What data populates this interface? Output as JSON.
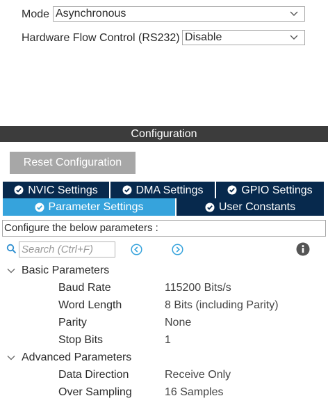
{
  "mode_section": {
    "mode_label": "Mode",
    "mode_value": "Asynchronous",
    "flow_label": "Hardware Flow Control (RS232)",
    "flow_value": "Disable"
  },
  "configuration": {
    "title": "Configuration",
    "reset_label": "Reset Configuration"
  },
  "tabs": {
    "nvic": "NVIC Settings",
    "dma": "DMA Settings",
    "gpio": "GPIO Settings",
    "parameter": "Parameter Settings",
    "user_constants": "User Constants"
  },
  "params_panel": {
    "hint": "Configure the below parameters :",
    "search_placeholder": "Search (Ctrl+F)"
  },
  "groups": {
    "basic": {
      "label": "Basic Parameters",
      "items": [
        {
          "name": "Baud Rate",
          "value": "115200 Bits/s"
        },
        {
          "name": "Word Length",
          "value": "8 Bits (including Parity)"
        },
        {
          "name": "Parity",
          "value": "None"
        },
        {
          "name": "Stop Bits",
          "value": "1"
        }
      ]
    },
    "advanced": {
      "label": "Advanced Parameters",
      "items": [
        {
          "name": "Data Direction",
          "value": "Receive Only"
        },
        {
          "name": "Over Sampling",
          "value": "16 Samples"
        }
      ]
    }
  },
  "colors": {
    "tab_dark": "#07294d",
    "tab_active": "#36a3dc",
    "config_bar": "#3c3c3c",
    "reset_button": "#a7a7a7",
    "nav_icon": "#36a3dc"
  },
  "icons": {
    "chevron": "chevron-down-icon",
    "check": "check-circle-icon",
    "search": "search-icon",
    "prev": "previous-icon",
    "next": "next-icon",
    "info": "info-icon",
    "expand": "expand-chevron-icon"
  }
}
